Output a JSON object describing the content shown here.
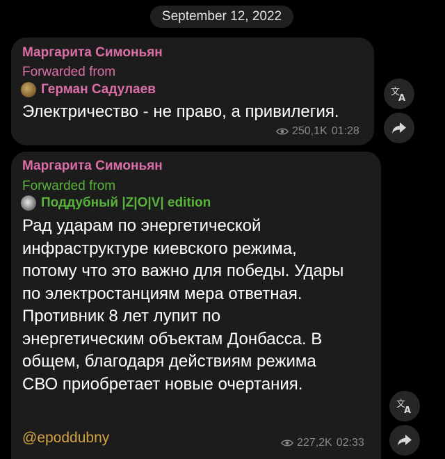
{
  "date_separator": "September 12, 2022",
  "messages": [
    {
      "author": "Маргарита Симоньян",
      "forwarded_label": "Forwarded from",
      "forwarded_from": "Герман Садулаев",
      "text_lines": [
        "Электричество - не право, а привилегия."
      ],
      "views": "250,1K",
      "time": "01:28"
    },
    {
      "author": "Маргарита Симоньян",
      "forwarded_label": "Forwarded from",
      "forwarded_from": "Поддубный |Z|O|V| edition",
      "text_lines": [
        "Рад ударам по энергетической",
        "инфраструктуре киевского режима,",
        "потому что это важно для победы. Удары",
        "по электростанциям мера ответная.",
        "Противник 8 лет лупит по",
        "энергетическим объектам Донбасса. В",
        "общем, благодаря действиям режима",
        "СВО приобретает новые очертания."
      ],
      "handle": "@epoddubny",
      "views": "227,2K",
      "time": "02:33"
    }
  ],
  "icons": {
    "translate": "translate-icon",
    "share": "share-arrow-icon",
    "views": "eye-icon"
  },
  "colors": {
    "author": "#dc6ea8",
    "forwarded_1": "#dc6ea8",
    "forwarded_2": "#58b33a",
    "handle": "#d4a340",
    "bubble": "#1c1c1d",
    "background": "#000000"
  }
}
